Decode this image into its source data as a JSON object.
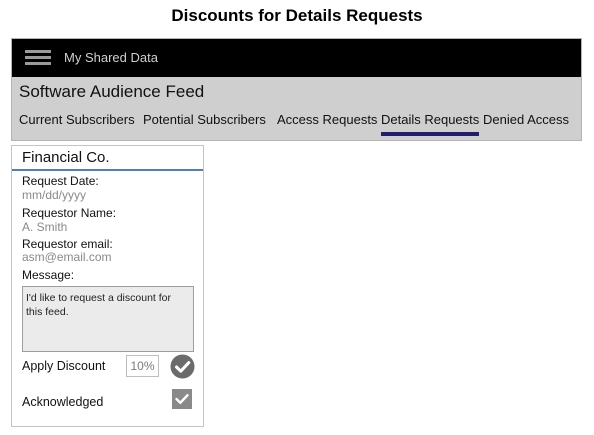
{
  "page": {
    "title": "Discounts for Details Requests"
  },
  "header": {
    "menu_icon": "hamburger-menu-icon",
    "brand": "My Shared Data"
  },
  "feed": {
    "title": "Software Audience Feed"
  },
  "tabs": [
    {
      "label": "Current Subscribers"
    },
    {
      "label": "Potential Subscribers"
    },
    {
      "label": "Access Requests"
    },
    {
      "label": "Details Requests",
      "active": true
    },
    {
      "label": "Denied Access"
    }
  ],
  "request": {
    "company": "Financial Co.",
    "request_date_label": "Request Date:",
    "request_date_value": "mm/dd/yyyy",
    "requestor_name_label": "Requestor Name:",
    "requestor_name_value": "A. Smith",
    "requestor_email_label": "Requestor email:",
    "requestor_email_value": "asm@email.com",
    "message_label": "Message:",
    "message_text": "I'd like to request a discount for this feed.",
    "apply_discount_label": "Apply Discount",
    "discount_value": "10%",
    "approve_icon": "check-circle-icon",
    "acknowledged_label": "Acknowledged",
    "acknowledged_checked": true
  },
  "colors": {
    "topbar": "#000000",
    "app_bg": "#cfcfcf",
    "active_tab_underline": "#1f1f6b",
    "company_rule": "#4d7fc4",
    "check_gray": "#6b6b6b"
  }
}
